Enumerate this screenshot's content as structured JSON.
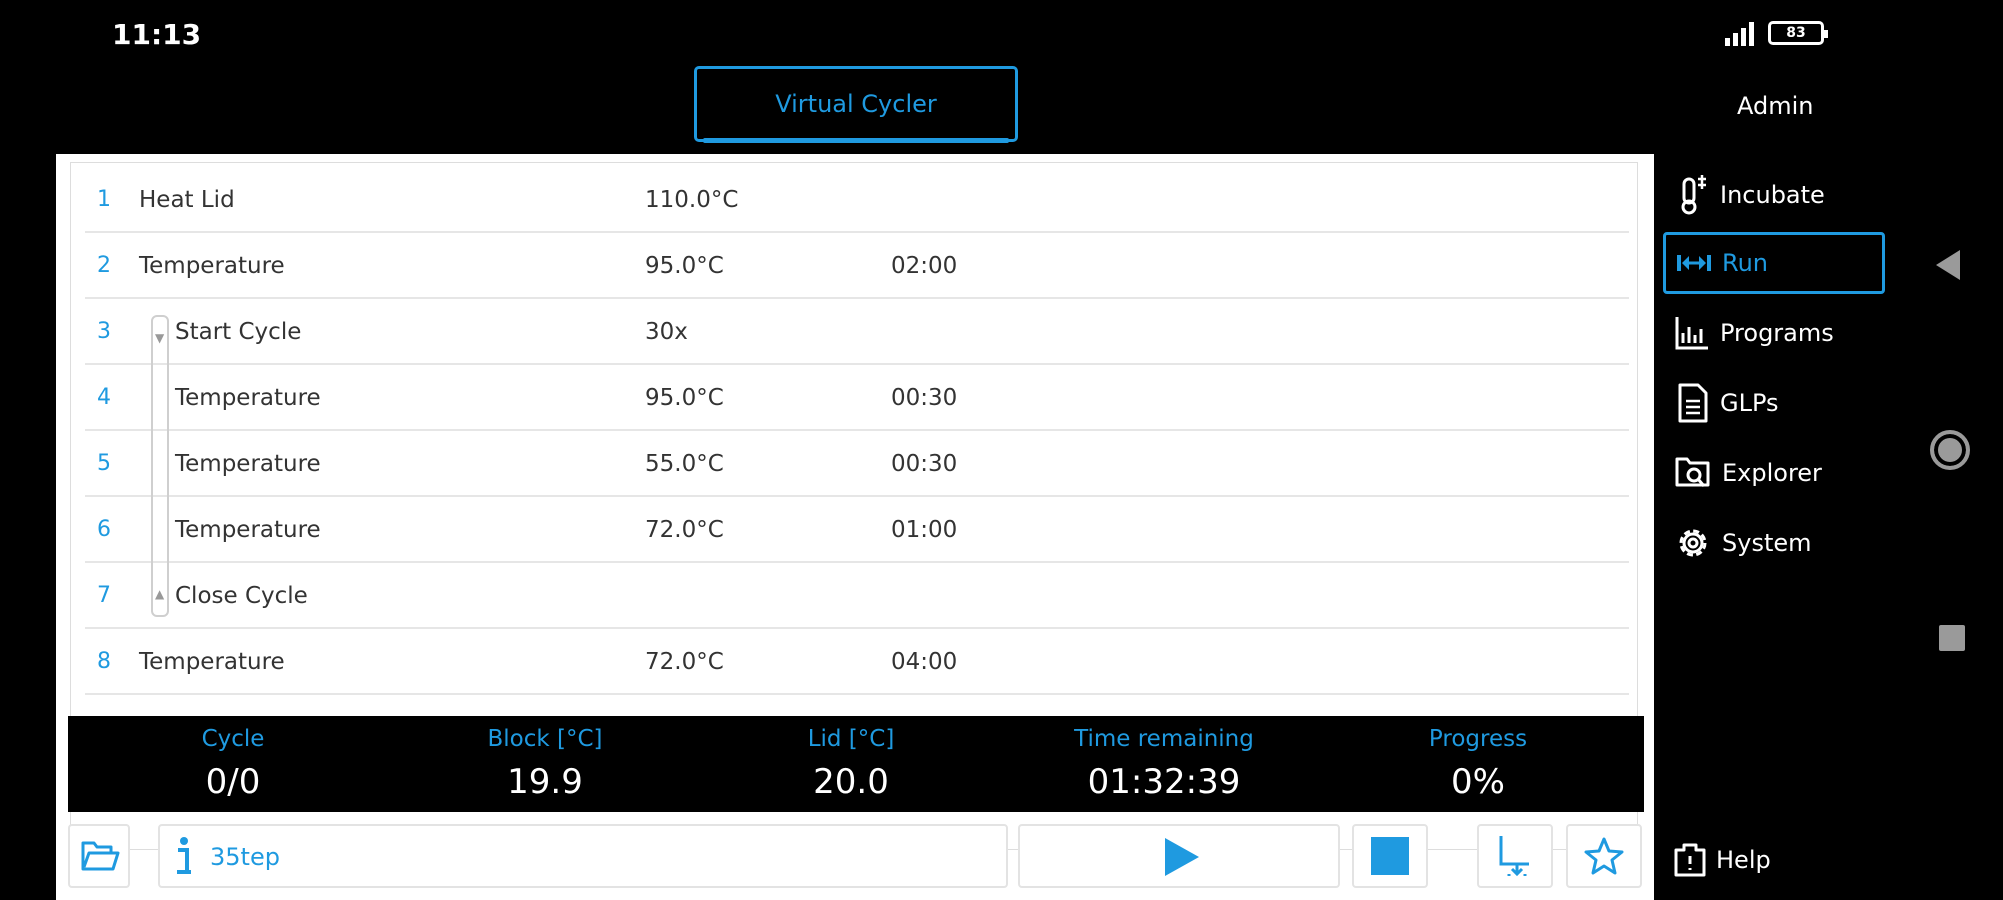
{
  "status_bar": {
    "time": "11:13",
    "battery": "83"
  },
  "header": {
    "tab_label": "Virtual Cycler",
    "user": "Admin"
  },
  "steps": [
    {
      "num": "1",
      "name": "Heat Lid",
      "value": "110.0°C",
      "time": ""
    },
    {
      "num": "2",
      "name": "Temperature",
      "value": "95.0°C",
      "time": "02:00"
    },
    {
      "num": "3",
      "name": "Start Cycle",
      "value": "30x",
      "time": ""
    },
    {
      "num": "4",
      "name": "Temperature",
      "value": "95.0°C",
      "time": "00:30"
    },
    {
      "num": "5",
      "name": "Temperature",
      "value": "55.0°C",
      "time": "00:30"
    },
    {
      "num": "6",
      "name": "Temperature",
      "value": "72.0°C",
      "time": "01:00"
    },
    {
      "num": "7",
      "name": "Close Cycle",
      "value": "",
      "time": ""
    },
    {
      "num": "8",
      "name": "Temperature",
      "value": "72.0°C",
      "time": "04:00"
    }
  ],
  "info": {
    "cycle_label": "Cycle",
    "cycle_value": "0/0",
    "block_label": "Block [°C]",
    "block_value": "19.9",
    "lid_label": "Lid [°C]",
    "lid_value": "20.0",
    "time_label": "Time remaining",
    "time_value": "01:32:39",
    "progress_label": "Progress",
    "progress_value": "0%"
  },
  "controls": {
    "program_name": "35tep"
  },
  "nav": {
    "incubate": "Incubate",
    "run": "Run",
    "programs": "Programs",
    "glps": "GLPs",
    "explorer": "Explorer",
    "system": "System",
    "help": "Help"
  },
  "colors": {
    "accent": "#1f9ae0",
    "panel": "#ffffff",
    "background": "#000000"
  }
}
